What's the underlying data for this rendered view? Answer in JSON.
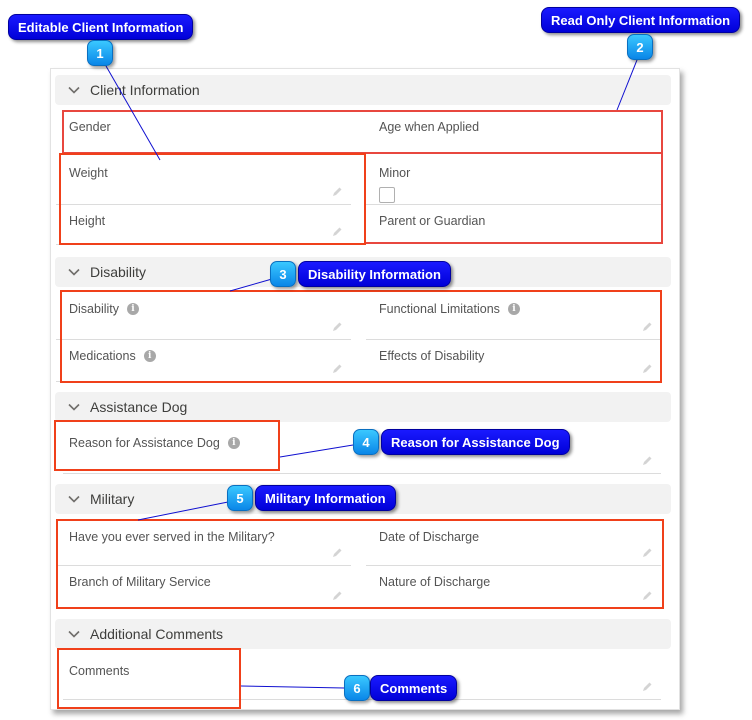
{
  "colors": {
    "annotation_box": "#e8473f",
    "annotation_box_alt": "#f0401a",
    "callout_bg": "#0000e6",
    "badge_bg": "#1aa8f5",
    "leader_line": "#1010d0",
    "section_header_bg": "#f2f2f2"
  },
  "sections": [
    {
      "title": "Client Information",
      "icon": "chevron-down-icon",
      "fields": [
        {
          "label": "Gender",
          "editable": false
        },
        {
          "label": "Age when Applied",
          "editable": false
        },
        {
          "label": "Weight",
          "editable": true
        },
        {
          "label": "Minor",
          "editable": false,
          "type": "checkbox",
          "checked": false
        },
        {
          "label": "Height",
          "editable": true
        },
        {
          "label": "Parent or Guardian",
          "editable": false
        }
      ]
    },
    {
      "title": "Disability",
      "icon": "chevron-down-icon",
      "fields": [
        {
          "label": "Disability",
          "editable": true,
          "help": true
        },
        {
          "label": "Functional Limitations",
          "editable": true,
          "help": true
        },
        {
          "label": "Medications",
          "editable": true,
          "help": true
        },
        {
          "label": "Effects of Disability",
          "editable": true
        }
      ]
    },
    {
      "title": "Assistance Dog",
      "icon": "chevron-down-icon",
      "fields": [
        {
          "label": "Reason for Assistance Dog",
          "editable": true,
          "help": true
        }
      ]
    },
    {
      "title": "Military",
      "icon": "chevron-down-icon",
      "fields": [
        {
          "label": "Have you ever served in the Military?",
          "editable": true
        },
        {
          "label": "Date of Discharge",
          "editable": true
        },
        {
          "label": "Branch of Military Service",
          "editable": true
        },
        {
          "label": "Nature of Discharge",
          "editable": true
        }
      ]
    },
    {
      "title": "Additional Comments",
      "icon": "chevron-down-icon",
      "fields": [
        {
          "label": "Comments",
          "editable": true
        }
      ]
    }
  ],
  "annotations": [
    {
      "number": "1",
      "label": "Editable Client Information"
    },
    {
      "number": "2",
      "label": "Read Only Client Information"
    },
    {
      "number": "3",
      "label": "Disability Information"
    },
    {
      "number": "4",
      "label": "Reason for Assistance Dog"
    },
    {
      "number": "5",
      "label": "Military Information"
    },
    {
      "number": "6",
      "label": "Comments"
    }
  ]
}
